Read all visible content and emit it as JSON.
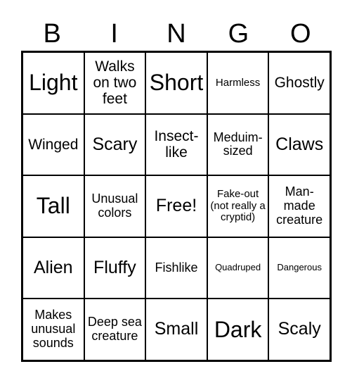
{
  "header": [
    "B",
    "I",
    "N",
    "G",
    "O"
  ],
  "cells": [
    [
      "Light",
      "Walks on two feet",
      "Short",
      "Harmless",
      "Ghostly"
    ],
    [
      "Winged",
      "Scary",
      "Insect-like",
      "Meduim-sized",
      "Claws"
    ],
    [
      "Tall",
      "Unusual colors",
      "Free!",
      "Fake-out (not really a cryptid)",
      "Man-made creature"
    ],
    [
      "Alien",
      "Fluffy",
      "Fishlike",
      "Quadruped",
      "Dangerous"
    ],
    [
      "Makes unusual sounds",
      "Deep sea creature",
      "Small",
      "Dark",
      "Scaly"
    ]
  ]
}
